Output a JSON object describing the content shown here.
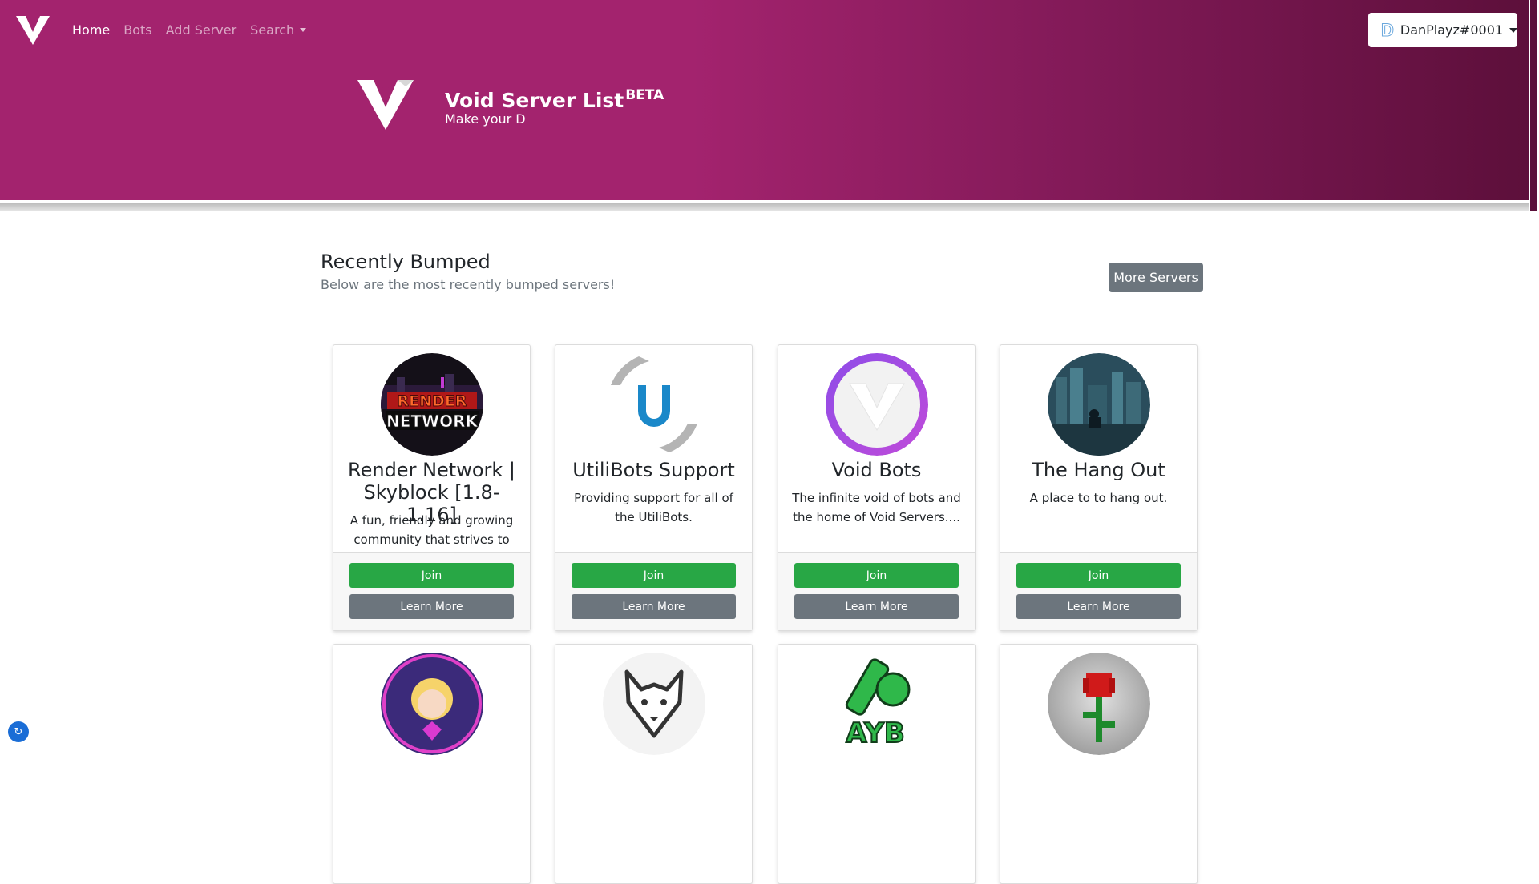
{
  "nav": {
    "items": [
      {
        "label": "Home",
        "active": true
      },
      {
        "label": "Bots"
      },
      {
        "label": "Add Server"
      },
      {
        "label": "Search",
        "dropdown": true
      }
    ],
    "user": {
      "avatar_letter": "D",
      "name": "DanPlayz#0001"
    }
  },
  "hero": {
    "title": "Void Server List",
    "badge": "BETA",
    "typed_subtitle": "Make your D"
  },
  "section": {
    "title": "Recently Bumped",
    "subtitle": "Below are the most recently bumped servers!",
    "more_label": "More Servers"
  },
  "cards": [
    {
      "name": "Render Network | Skyblock [1.8-1.16]",
      "description": "A fun, friendly and growing community that strives to g...",
      "join": "Join",
      "learn": "Learn More",
      "icon": "render-network-logo"
    },
    {
      "name": "UtiliBots Support",
      "description": "Providing support for all of the UtiliBots.",
      "join": "Join",
      "learn": "Learn More",
      "icon": "utilibots-logo"
    },
    {
      "name": "Void Bots",
      "description": "The infinite void of bots and the home of Void Servers....",
      "join": "Join",
      "learn": "Learn More",
      "icon": "void-bots-logo"
    },
    {
      "name": "The Hang Out",
      "description": "A place to to hang out.",
      "join": "Join",
      "learn": "Learn More",
      "icon": "city-night-art"
    },
    {
      "icon": "anime-girl-art"
    },
    {
      "icon": "wolf-logo"
    },
    {
      "icon": "ayb-logo",
      "logo_text": "AYB"
    },
    {
      "icon": "rose-pixel-art"
    }
  ],
  "colors": {
    "hero_gradient_start": "#a3236e",
    "hero_gradient_end": "#5c0f3a",
    "join_button": "#28a745",
    "secondary_button": "#6c757d"
  }
}
